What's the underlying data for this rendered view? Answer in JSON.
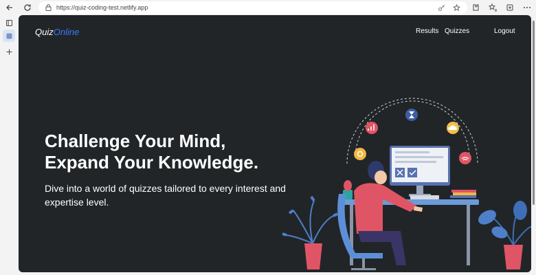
{
  "browser": {
    "url": "https://quiz-coding-test.netlify.app"
  },
  "navbar": {
    "brand_part1": "Quiz",
    "brand_part2": "Online",
    "links": [
      "Results",
      "Quizzes"
    ],
    "logout": "Logout"
  },
  "hero": {
    "headline_line1": "Challenge Your Mind,",
    "headline_line2": "Expand Your Knowledge.",
    "subtitle": "Dive into a world of quizzes tailored to every interest and expertise level."
  },
  "colors": {
    "background": "#212528",
    "brand_accent": "#3a7bff",
    "text": "#ffffff"
  }
}
